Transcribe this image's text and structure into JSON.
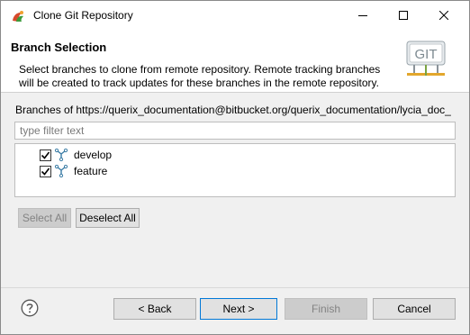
{
  "window": {
    "title": "Clone Git Repository"
  },
  "header": {
    "title": "Branch Selection",
    "description": "Select branches to clone from remote repository. Remote tracking branches will be created to track updates for these branches in the remote repository.",
    "logo_text": "GIT"
  },
  "branches": {
    "label": "Branches of https://querix_documentation@bitbucket.org/querix_documentation/lycia_doc_",
    "filter_placeholder": "type filter text",
    "filter_value": "",
    "items": [
      {
        "name": "develop",
        "checked": true
      },
      {
        "name": "feature",
        "checked": true
      }
    ]
  },
  "buttons": {
    "select_all": "Select All",
    "deselect_all": "Deselect All",
    "back": "< Back",
    "next": "Next >",
    "finish": "Finish",
    "cancel": "Cancel"
  },
  "colors": {
    "accent": "#0078d7",
    "branch_icon": "#3a7ca5",
    "disabled_text": "#838383"
  }
}
